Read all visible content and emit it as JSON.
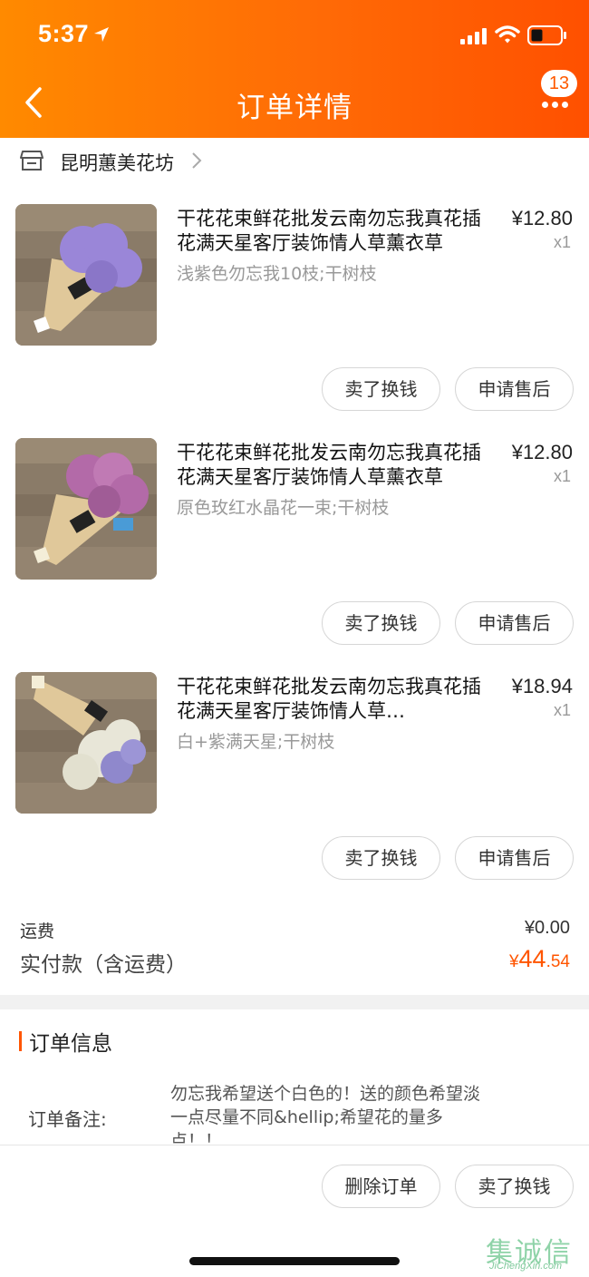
{
  "status_bar": {
    "time": "5:37"
  },
  "header": {
    "title": "订单详情",
    "badge_count": "13"
  },
  "shop": {
    "name": "昆明蕙美花坊"
  },
  "items": [
    {
      "title": "干花花束鲜花批发云南勿忘我真花插花满天星客厅装饰情人草薰衣草",
      "sku": "浅紫色勿忘我10枝;干树枝",
      "price": "¥12.80",
      "qty": "x1",
      "flower_color": "#9a86d8",
      "actions": [
        "卖了换钱",
        "申请售后"
      ]
    },
    {
      "title": "干花花束鲜花批发云南勿忘我真花插花满天星客厅装饰情人草薰衣草",
      "sku": "原色玫红水晶花一束;干树枝",
      "price": "¥12.80",
      "qty": "x1",
      "flower_color": "#b36aa8",
      "actions": [
        "卖了换钱",
        "申请售后"
      ]
    },
    {
      "title": "干花花束鲜花批发云南勿忘我真花插花满天星客厅装饰情人草…",
      "sku": "白+紫满天星;干树枝",
      "price": "¥18.94",
      "qty": "x1",
      "flower_color": "#e8e6d8",
      "actions": [
        "卖了换钱",
        "申请售后"
      ]
    }
  ],
  "summary": {
    "shipping_label": "运费",
    "shipping_value": "¥0.00",
    "paid_label": "实付款（含运费）",
    "paid_currency": "¥",
    "paid_int": "44",
    "paid_dec": ".54"
  },
  "order_info": {
    "section_title": "订单信息",
    "note_label": "订单备注:",
    "note_text": "勿忘我希望送个白色的！送的颜色希望淡一点尽量不同&hellip;希望花的量多点！！"
  },
  "bottom_actions": [
    "删除订单",
    "卖了换钱"
  ],
  "watermark": {
    "chars": "集诚信",
    "url": "JiChengXin.com"
  },
  "colors": {
    "accent": "#ff5500",
    "header_start": "#ff8a00",
    "header_end": "#ff5000"
  }
}
